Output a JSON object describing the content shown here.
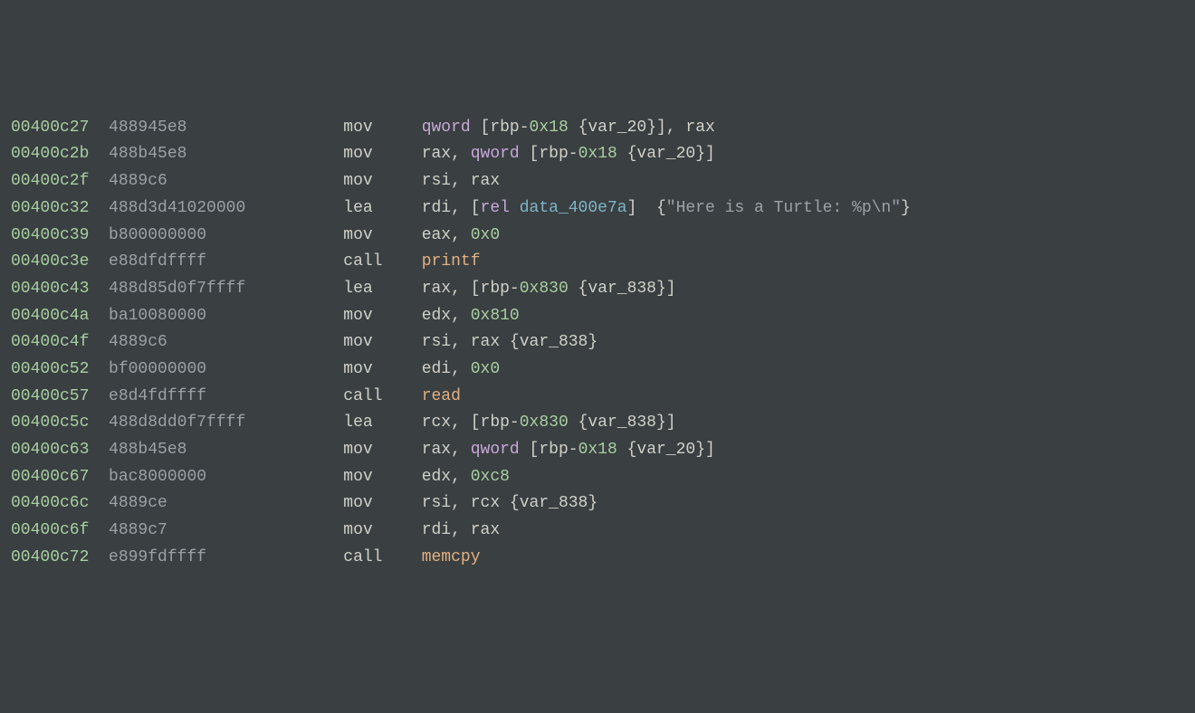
{
  "lines": [
    {
      "addr": "00400c27",
      "bytes": "488945e8",
      "mnemonic": "mov",
      "tokens": [
        {
          "t": "kw",
          "v": "qword"
        },
        {
          "t": "punct",
          "v": " ["
        },
        {
          "t": "reg",
          "v": "rbp"
        },
        {
          "t": "punct",
          "v": "-"
        },
        {
          "t": "num",
          "v": "0x18"
        },
        {
          "t": "punct",
          "v": " {"
        },
        {
          "t": "var",
          "v": "var_20"
        },
        {
          "t": "punct",
          "v": "}], "
        },
        {
          "t": "reg",
          "v": "rax"
        }
      ]
    },
    {
      "addr": "00400c2b",
      "bytes": "488b45e8",
      "mnemonic": "mov",
      "tokens": [
        {
          "t": "reg",
          "v": "rax"
        },
        {
          "t": "punct",
          "v": ", "
        },
        {
          "t": "kw",
          "v": "qword"
        },
        {
          "t": "punct",
          "v": " ["
        },
        {
          "t": "reg",
          "v": "rbp"
        },
        {
          "t": "punct",
          "v": "-"
        },
        {
          "t": "num",
          "v": "0x18"
        },
        {
          "t": "punct",
          "v": " {"
        },
        {
          "t": "var",
          "v": "var_20"
        },
        {
          "t": "punct",
          "v": "}]"
        }
      ]
    },
    {
      "addr": "00400c2f",
      "bytes": "4889c6",
      "mnemonic": "mov",
      "tokens": [
        {
          "t": "reg",
          "v": "rsi"
        },
        {
          "t": "punct",
          "v": ", "
        },
        {
          "t": "reg",
          "v": "rax"
        }
      ]
    },
    {
      "addr": "00400c32",
      "bytes": "488d3d41020000",
      "mnemonic": "lea",
      "tokens": [
        {
          "t": "reg",
          "v": "rdi"
        },
        {
          "t": "punct",
          "v": ", ["
        },
        {
          "t": "kw",
          "v": "rel"
        },
        {
          "t": "punct",
          "v": " "
        },
        {
          "t": "dataref",
          "v": "data_400e7a"
        },
        {
          "t": "punct",
          "v": "]  {"
        },
        {
          "t": "str",
          "v": "\"Here is a Turtle: %p\\n\""
        },
        {
          "t": "punct",
          "v": "}"
        }
      ]
    },
    {
      "addr": "00400c39",
      "bytes": "b800000000",
      "mnemonic": "mov",
      "tokens": [
        {
          "t": "reg",
          "v": "eax"
        },
        {
          "t": "punct",
          "v": ", "
        },
        {
          "t": "num",
          "v": "0x0"
        }
      ]
    },
    {
      "addr": "00400c3e",
      "bytes": "e88dfdffff",
      "mnemonic": "call",
      "tokens": [
        {
          "t": "sym",
          "v": "printf"
        }
      ]
    },
    {
      "addr": "00400c43",
      "bytes": "488d85d0f7ffff",
      "mnemonic": "lea",
      "tokens": [
        {
          "t": "reg",
          "v": "rax"
        },
        {
          "t": "punct",
          "v": ", ["
        },
        {
          "t": "reg",
          "v": "rbp"
        },
        {
          "t": "punct",
          "v": "-"
        },
        {
          "t": "num",
          "v": "0x830"
        },
        {
          "t": "punct",
          "v": " {"
        },
        {
          "t": "var",
          "v": "var_838"
        },
        {
          "t": "punct",
          "v": "}]"
        }
      ]
    },
    {
      "addr": "00400c4a",
      "bytes": "ba10080000",
      "mnemonic": "mov",
      "tokens": [
        {
          "t": "reg",
          "v": "edx"
        },
        {
          "t": "punct",
          "v": ", "
        },
        {
          "t": "num",
          "v": "0x810"
        }
      ]
    },
    {
      "addr": "00400c4f",
      "bytes": "4889c6",
      "mnemonic": "mov",
      "tokens": [
        {
          "t": "reg",
          "v": "rsi"
        },
        {
          "t": "punct",
          "v": ", "
        },
        {
          "t": "reg",
          "v": "rax"
        },
        {
          "t": "punct",
          "v": " {"
        },
        {
          "t": "var",
          "v": "var_838"
        },
        {
          "t": "punct",
          "v": "}"
        }
      ]
    },
    {
      "addr": "00400c52",
      "bytes": "bf00000000",
      "mnemonic": "mov",
      "tokens": [
        {
          "t": "reg",
          "v": "edi"
        },
        {
          "t": "punct",
          "v": ", "
        },
        {
          "t": "num",
          "v": "0x0"
        }
      ]
    },
    {
      "addr": "00400c57",
      "bytes": "e8d4fdffff",
      "mnemonic": "call",
      "tokens": [
        {
          "t": "sym",
          "v": "read"
        }
      ]
    },
    {
      "addr": "00400c5c",
      "bytes": "488d8dd0f7ffff",
      "mnemonic": "lea",
      "tokens": [
        {
          "t": "reg",
          "v": "rcx"
        },
        {
          "t": "punct",
          "v": ", ["
        },
        {
          "t": "reg",
          "v": "rbp"
        },
        {
          "t": "punct",
          "v": "-"
        },
        {
          "t": "num",
          "v": "0x830"
        },
        {
          "t": "punct",
          "v": " {"
        },
        {
          "t": "var",
          "v": "var_838"
        },
        {
          "t": "punct",
          "v": "}]"
        }
      ]
    },
    {
      "addr": "00400c63",
      "bytes": "488b45e8",
      "mnemonic": "mov",
      "tokens": [
        {
          "t": "reg",
          "v": "rax"
        },
        {
          "t": "punct",
          "v": ", "
        },
        {
          "t": "kw",
          "v": "qword"
        },
        {
          "t": "punct",
          "v": " ["
        },
        {
          "t": "reg",
          "v": "rbp"
        },
        {
          "t": "punct",
          "v": "-"
        },
        {
          "t": "num",
          "v": "0x18"
        },
        {
          "t": "punct",
          "v": " {"
        },
        {
          "t": "var",
          "v": "var_20"
        },
        {
          "t": "punct",
          "v": "}]"
        }
      ]
    },
    {
      "addr": "00400c67",
      "bytes": "bac8000000",
      "mnemonic": "mov",
      "tokens": [
        {
          "t": "reg",
          "v": "edx"
        },
        {
          "t": "punct",
          "v": ", "
        },
        {
          "t": "num",
          "v": "0xc8"
        }
      ]
    },
    {
      "addr": "00400c6c",
      "bytes": "4889ce",
      "mnemonic": "mov",
      "tokens": [
        {
          "t": "reg",
          "v": "rsi"
        },
        {
          "t": "punct",
          "v": ", "
        },
        {
          "t": "reg",
          "v": "rcx"
        },
        {
          "t": "punct",
          "v": " {"
        },
        {
          "t": "var",
          "v": "var_838"
        },
        {
          "t": "punct",
          "v": "}"
        }
      ]
    },
    {
      "addr": "00400c6f",
      "bytes": "4889c7",
      "mnemonic": "mov",
      "tokens": [
        {
          "t": "reg",
          "v": "rdi"
        },
        {
          "t": "punct",
          "v": ", "
        },
        {
          "t": "reg",
          "v": "rax"
        }
      ]
    },
    {
      "addr": "00400c72",
      "bytes": "e899fdffff",
      "mnemonic": "call",
      "tokens": [
        {
          "t": "sym",
          "v": "memcpy"
        }
      ]
    }
  ],
  "columns": {
    "addr_width": 10,
    "bytes_width": 24,
    "mnem_width": 8
  }
}
